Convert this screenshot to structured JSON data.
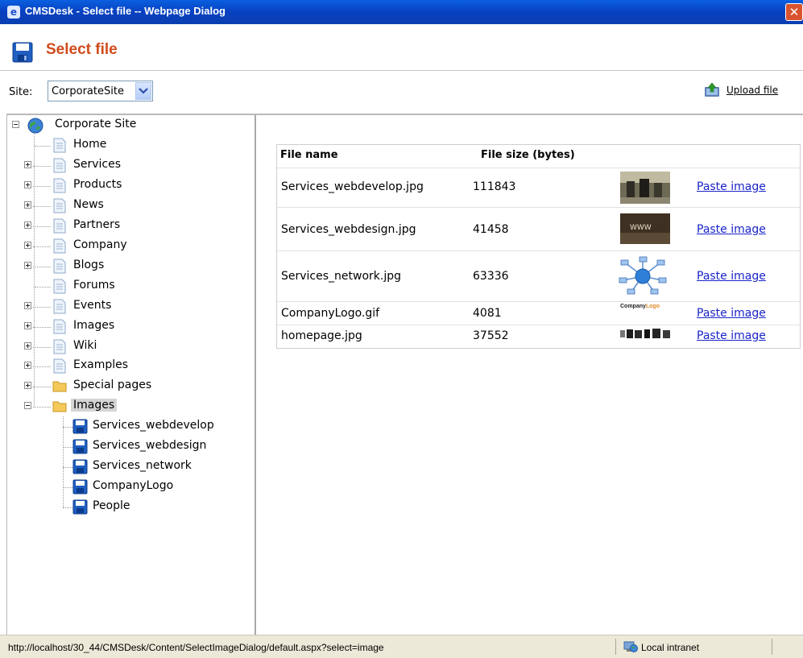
{
  "window": {
    "title": "CMSDesk - Select file -- Webpage Dialog",
    "close_glyph": "✕"
  },
  "header": {
    "title": "Select file"
  },
  "toolbar": {
    "site_label": "Site:",
    "site_value": "CorporateSite",
    "upload_label": "Upload file"
  },
  "tree": {
    "root": "Corporate Site",
    "items": [
      {
        "label": "Home",
        "icon": "page-icon",
        "expander": "none"
      },
      {
        "label": "Services",
        "icon": "page-icon",
        "expander": "plus"
      },
      {
        "label": "Products",
        "icon": "page-icon",
        "expander": "plus"
      },
      {
        "label": "News",
        "icon": "page-icon",
        "expander": "plus"
      },
      {
        "label": "Partners",
        "icon": "page-icon",
        "expander": "plus"
      },
      {
        "label": "Company",
        "icon": "page-icon",
        "expander": "plus"
      },
      {
        "label": "Blogs",
        "icon": "page-icon",
        "expander": "plus"
      },
      {
        "label": "Forums",
        "icon": "page-icon",
        "expander": "none"
      },
      {
        "label": "Events",
        "icon": "page-icon",
        "expander": "plus"
      },
      {
        "label": "Images",
        "icon": "page-icon",
        "expander": "plus"
      },
      {
        "label": "Wiki",
        "icon": "page-icon",
        "expander": "plus"
      },
      {
        "label": "Examples",
        "icon": "page-icon",
        "expander": "plus"
      },
      {
        "label": "Special pages",
        "icon": "folder-icon",
        "expander": "plus"
      },
      {
        "label": "Images",
        "icon": "folder-icon",
        "expander": "minus",
        "selected": true
      }
    ],
    "children": [
      {
        "label": "Services_webdevelop",
        "icon": "image-file-icon"
      },
      {
        "label": "Services_webdesign",
        "icon": "image-file-icon"
      },
      {
        "label": "Services_network",
        "icon": "image-file-icon"
      },
      {
        "label": "CompanyLogo",
        "icon": "image-file-icon"
      },
      {
        "label": "People",
        "icon": "image-file-icon"
      }
    ]
  },
  "files": {
    "columns": [
      "File name",
      "File size (bytes)"
    ],
    "rows": [
      {
        "name": "Services_webdevelop.jpg",
        "size": "111843",
        "action": "Paste image"
      },
      {
        "name": "Services_webdesign.jpg",
        "size": "41458",
        "action": "Paste image"
      },
      {
        "name": "Services_network.jpg",
        "size": "63336",
        "action": "Paste image"
      },
      {
        "name": "CompanyLogo.gif",
        "size": "4081",
        "action": "Paste image"
      },
      {
        "name": "homepage.jpg",
        "size": "37552",
        "action": "Paste image"
      }
    ],
    "thumb_text": {
      "webdesign": "WWW",
      "logo_a": "Company",
      "logo_b": "Logo"
    }
  },
  "statusbar": {
    "url": "http://localhost/30_44/CMSDesk/Content/SelectImageDialog/default.aspx?select=image",
    "zone": "Local intranet"
  },
  "colors": {
    "title_bar": "#0840c0",
    "header_title": "#d14b1c",
    "link": "#1a24c8",
    "status_bar": "#ece9d8"
  }
}
